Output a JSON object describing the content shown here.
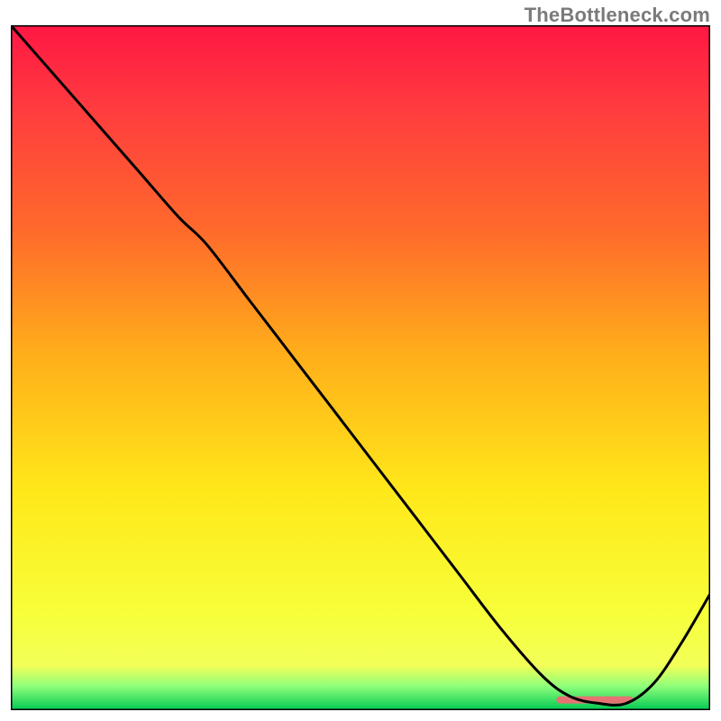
{
  "watermark": "TheBottleneck.com",
  "chart_data": {
    "type": "line",
    "title": "",
    "xlabel": "",
    "ylabel": "",
    "xlim": [
      0,
      100
    ],
    "ylim": [
      0,
      100
    ],
    "grid": false,
    "legend": false,
    "background_gradient_stops": [
      {
        "offset": 0.0,
        "color": "#ff1744"
      },
      {
        "offset": 0.12,
        "color": "#ff3b3f"
      },
      {
        "offset": 0.3,
        "color": "#ff6a2b"
      },
      {
        "offset": 0.48,
        "color": "#ffae1a"
      },
      {
        "offset": 0.68,
        "color": "#ffe81a"
      },
      {
        "offset": 0.86,
        "color": "#f7ff3a"
      },
      {
        "offset": 0.935,
        "color": "#f2ff58"
      },
      {
        "offset": 0.965,
        "color": "#8fff7a"
      },
      {
        "offset": 1.0,
        "color": "#00c853"
      }
    ],
    "annotations": [
      {
        "name": "optimal-marker",
        "x_start": 78,
        "x_end": 89,
        "y": 1.5,
        "color": "#e57373"
      }
    ],
    "series": [
      {
        "name": "bottleneck-curve",
        "color": "#000000",
        "x": [
          0,
          6,
          12,
          18,
          24,
          28,
          34,
          40,
          46,
          52,
          58,
          64,
          70,
          76,
          80,
          84,
          88,
          92,
          96,
          100
        ],
        "y": [
          100,
          93,
          86,
          79,
          72,
          68,
          60,
          52,
          44,
          36,
          28,
          20,
          12,
          5,
          2,
          1,
          1,
          4,
          10,
          17
        ]
      }
    ]
  }
}
